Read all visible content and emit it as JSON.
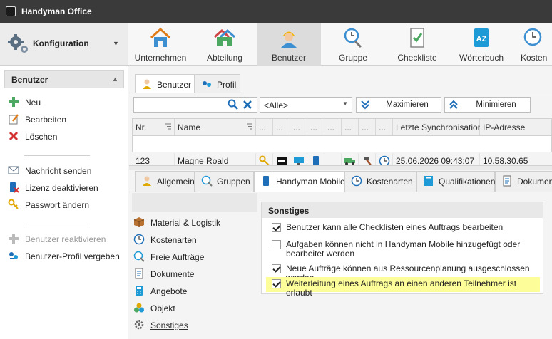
{
  "window": {
    "title": "Handyman Office"
  },
  "nav": {
    "title": "Konfiguration"
  },
  "ribbon": [
    {
      "label": "Unternehmen",
      "icon": "house-icon"
    },
    {
      "label": "Abteilung",
      "icon": "department-icon"
    },
    {
      "label": "Benutzer",
      "icon": "user-worker-icon",
      "active": true
    },
    {
      "label": "Gruppe",
      "icon": "group-clock-icon"
    },
    {
      "label": "Checkliste",
      "icon": "checklist-icon"
    },
    {
      "label": "Wörterbuch",
      "icon": "dictionary-icon"
    },
    {
      "label": "Kosten",
      "icon": "clock-icon"
    }
  ],
  "left_panel": {
    "header": "Benutzer",
    "actions": [
      {
        "label": "Neu",
        "icon": "plus-icon"
      },
      {
        "label": "Bearbeiten",
        "icon": "edit-icon"
      },
      {
        "label": "Löschen",
        "icon": "delete-x-icon"
      },
      {
        "label": "Nachricht senden",
        "icon": "envelope-icon"
      },
      {
        "label": "Lizenz deaktivieren",
        "icon": "device-disable-icon"
      },
      {
        "label": "Passwort ändern",
        "icon": "key-icon"
      },
      {
        "label": "Benutzer reaktivieren",
        "icon": "plus-icon",
        "disabled": true
      },
      {
        "label": "Benutzer-Profil vergeben",
        "icon": "profile-assign-icon"
      }
    ]
  },
  "top_tabs": [
    {
      "label": "Benutzer",
      "active": true
    },
    {
      "label": "Profil"
    }
  ],
  "toolbar": {
    "search_value": "",
    "filter_value": "<Alle>",
    "maximize_label": "Maximieren",
    "minimize_label": "Minimieren"
  },
  "grid": {
    "columns": [
      "Nr.",
      "Name",
      "...",
      "...",
      "...",
      "...",
      "...",
      "...",
      "...",
      "...",
      "Letzte Synchronisation",
      "IP-Adresse"
    ],
    "rows": [
      {
        "nr": "123",
        "name": "Magne Roald",
        "sync": "25.06.2026 09:43:07",
        "ip": "10.58.30.65"
      }
    ]
  },
  "detail_tabs": [
    {
      "label": "Allgemein"
    },
    {
      "label": "Gruppen"
    },
    {
      "label": "Handyman Mobile",
      "active": true
    },
    {
      "label": "Kostenarten"
    },
    {
      "label": "Qualifikationen"
    },
    {
      "label": "Dokumente"
    }
  ],
  "side_items": [
    {
      "label": "Material & Logistik",
      "icon": "box-icon"
    },
    {
      "label": "Kostenarten",
      "icon": "clock-icon"
    },
    {
      "label": "Freie Aufträge",
      "icon": "task-icon"
    },
    {
      "label": "Dokumente",
      "icon": "document-icon"
    },
    {
      "label": "Angebote",
      "icon": "calculator-icon"
    },
    {
      "label": "Objekt",
      "icon": "object-icon"
    },
    {
      "label": "Sonstiges",
      "icon": "gear-icon",
      "active": true
    }
  ],
  "sonstiges": {
    "title": "Sonstiges",
    "options": [
      {
        "label": "Benutzer kann alle Checklisten eines Auftrags bearbeiten",
        "checked": true
      },
      {
        "label": "Aufgaben können nicht in Handyman Mobile hinzugefügt oder bearbeitet werden",
        "checked": false
      },
      {
        "label": "Neue Aufträge können aus Ressourcenplanung ausgeschlossen werden",
        "checked": true
      },
      {
        "label": "Weiterleitung eines Auftrags an einen anderen Teilnehmer ist erlaubt",
        "checked": true,
        "highlighted": true
      }
    ]
  }
}
